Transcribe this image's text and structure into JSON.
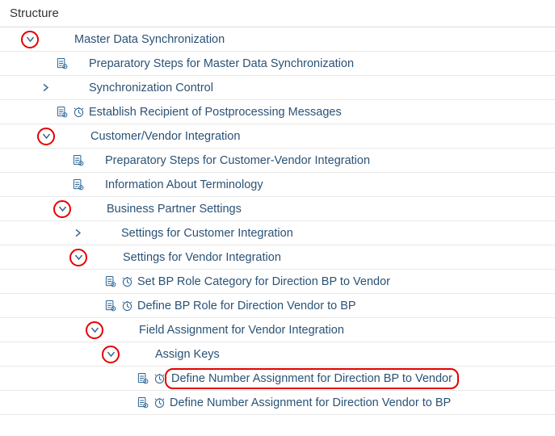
{
  "header": {
    "title": "Structure"
  },
  "rows": [
    {
      "indent": 1,
      "expander": "down",
      "circled": true,
      "label": "Master Data Synchronization",
      "icons": [
        "none",
        "none"
      ]
    },
    {
      "indent": 2,
      "expander": "none",
      "circled": false,
      "label": "Preparatory Steps for Master Data Synchronization",
      "icons": [
        "doc",
        "none"
      ]
    },
    {
      "indent": 2,
      "expander": "right",
      "circled": false,
      "label": "Synchronization Control",
      "icons": [
        "none",
        "none"
      ]
    },
    {
      "indent": 2,
      "expander": "none",
      "circled": false,
      "label": "Establish Recipient of Postprocessing Messages",
      "icons": [
        "doc",
        "clock"
      ]
    },
    {
      "indent": 2,
      "expander": "down",
      "circled": true,
      "label": "Customer/Vendor Integration",
      "icons": [
        "none",
        "none"
      ]
    },
    {
      "indent": 3,
      "expander": "none",
      "circled": false,
      "label": "Preparatory Steps for Customer-Vendor Integration",
      "icons": [
        "doc",
        "none"
      ]
    },
    {
      "indent": 3,
      "expander": "none",
      "circled": false,
      "label": "Information About Terminology",
      "icons": [
        "doc",
        "none"
      ]
    },
    {
      "indent": 3,
      "expander": "down",
      "circled": true,
      "label": "Business Partner Settings",
      "icons": [
        "none",
        "none"
      ]
    },
    {
      "indent": 4,
      "expander": "right",
      "circled": false,
      "label": "Settings for Customer Integration",
      "icons": [
        "none",
        "none"
      ]
    },
    {
      "indent": 4,
      "expander": "down",
      "circled": true,
      "label": "Settings for Vendor Integration",
      "icons": [
        "none",
        "none"
      ]
    },
    {
      "indent": 5,
      "expander": "none",
      "circled": false,
      "label": "Set BP Role Category for Direction BP to Vendor",
      "icons": [
        "doc",
        "clock"
      ]
    },
    {
      "indent": 5,
      "expander": "none",
      "circled": false,
      "label": "Define BP Role for Direction Vendor to BP",
      "icons": [
        "doc",
        "clock"
      ]
    },
    {
      "indent": 5,
      "expander": "down",
      "circled": true,
      "label": "Field Assignment for Vendor Integration",
      "icons": [
        "none",
        "none"
      ]
    },
    {
      "indent": 6,
      "expander": "down",
      "circled": true,
      "label": "Assign Keys",
      "icons": [
        "none",
        "none"
      ]
    },
    {
      "indent": 7,
      "expander": "none",
      "circled": false,
      "label": "Define Number Assignment for Direction BP to Vendor",
      "icons": [
        "doc",
        "clock"
      ],
      "highlight": true
    },
    {
      "indent": 7,
      "expander": "none",
      "circled": false,
      "label": "Define Number Assignment for Direction Vendor to BP",
      "icons": [
        "doc",
        "clock"
      ]
    }
  ]
}
